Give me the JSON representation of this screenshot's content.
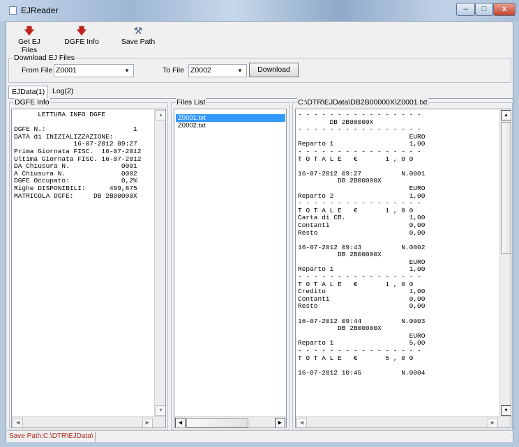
{
  "window": {
    "title": "EJReader",
    "minimize": "–",
    "maximize": "□",
    "close": "x"
  },
  "toolbar": {
    "get_ej_files": "Get EJ Files",
    "dgfe_info": "DGFE Info",
    "save_path": "Save Path",
    "arrow_icon": "🡇",
    "hammer_icon": "⚒"
  },
  "download": {
    "group_title": "Download EJ Files",
    "from_label": "From File",
    "from_value": "Z0001",
    "to_label": "To File",
    "to_value": "Z0002",
    "button": "Download"
  },
  "tabs": {
    "ejdata": "EJData(1)",
    "log": "Log(2)"
  },
  "dgfe_panel": {
    "title": "DGFE Info",
    "text": "      LETTURA INFO DGFE\n\nDGFE N.:                      1\nDATA di INIZIALIZZAZIONE:\n               16-07-2012 09:27\nPrima Giornata FISC.  16-07-2012\nUltima Giornata FISC. 16-07-2012\nDA Chiusura N.             0001\nA Chiusura N.              0002\nDGFE Occupato:             0,2%\nRighe DISPONIBILI:      499,875\nMATRICOLA DGFE:     DB 2B00000X"
  },
  "files_panel": {
    "title": "Files List",
    "items": [
      "Z0001.txt",
      "Z0002.txt"
    ]
  },
  "file_view": {
    "title": "C:\\DTR\\EJData\\DB2B00000X\\Z0001.txt",
    "text": "- - - - - - - - - - - - - - - -\n        DB 2B00000X\n- - - - - - - - - - - - - - - -\n                            EURO\nReparto 1                   1,00\n- - - - - - - - - - - - - - - -\nT O T A L E   €       1 , 0 0\n\n16-07-2012 09:27          N.0001\n          DB 2B00000X\n                            EURO\nReparto 2                   1,00\n- - - - - - - - - - - - - - - -\nT O T A L E   €       1 , 0 0\nCarta di CR.                1,00\nContanti                    0,00\nResto                       0,00\n\n16-07-2012 09:43          N.0002\n          DB 2B00000X\n                            EURO\nReparto 1                   1,00\n- - - - - - - - - - - - - - - -\nT O T A L E   €       1 , 0 0\nCredito                     1,00\nContanti                    0,00\nResto                       0,00\n\n16-07-2012 09:44          N.0003\n          DB 2B00000X\n                            EURO\nReparto 1                   5,00\n- - - - - - - - - - - - - - - -\nT O T A L E   €       5 , 0 0\n\n16-07-2012 10:45          N.0004"
  },
  "scroll_glyphs": {
    "up": "▲",
    "down": "▼",
    "left": "◀",
    "right": "▶"
  },
  "status": {
    "save_path": "Save Path:C:\\DTR\\EJData\\",
    "grip": "⋰"
  }
}
